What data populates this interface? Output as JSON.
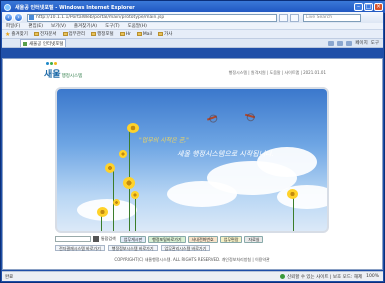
{
  "window": {
    "title": "새울공 인터넷포털 - Windows Internet Explorer"
  },
  "address": {
    "url": "http://10.1.1.1/PortalWeb/portal/main/prototype/main.jsp",
    "search_placeholder": "Live Search"
  },
  "menu": [
    "파일(F)",
    "편집(E)",
    "보기(V)",
    "즐겨찾기(A)",
    "도구(T)",
    "도움말(H)"
  ],
  "favorites": {
    "label": "즐겨찾기",
    "items": [
      "전자문서",
      "업무관리",
      "행정포털",
      "Hr",
      "Mail",
      "가사"
    ]
  },
  "tab": {
    "label": "새울공 인터넷포털"
  },
  "commands": {
    "page": "페이지",
    "tools": "도구"
  },
  "site": {
    "logo_main": "새울",
    "logo_sub": "행정시스템",
    "info_line": "행정시스템 | 원격지원 | 도움말 | 사이트맵 | 2021.01.01",
    "logo_colors": [
      "#1e88c8",
      "#3fae49",
      "#f2b51b"
    ]
  },
  "banner": {
    "slogan1": "\"업무의 시작은 곧,\"",
    "slogan2": "새울 행정시스템으로 시작됩니다."
  },
  "quick": {
    "search_label": "통합검색",
    "buttons": [
      {
        "label": "업무게시판",
        "color": "#dfe9f6"
      },
      {
        "label": "행정포털바로가기",
        "color": "#d8efd2"
      },
      {
        "label": "사내전화번호",
        "color": "#f8e2c8"
      },
      {
        "label": "업무편람",
        "color": "#f6f1c6"
      },
      {
        "label": "자료실",
        "color": "#e8e8e8"
      }
    ]
  },
  "links": [
    "전자결재시스템 바로가기",
    "행정정보시스템 바로가기",
    "업무관리시스템 바로가기"
  ],
  "footer": "COPYRIGHT(C) 새울행정시스템. ALL RIGHTS RESERVED. 개인정보처리방침 | 이용약관",
  "status": {
    "done": "완료",
    "zone": "신뢰할 수 있는 사이트 | 보호 모드: 해제",
    "zoom": "100%"
  }
}
